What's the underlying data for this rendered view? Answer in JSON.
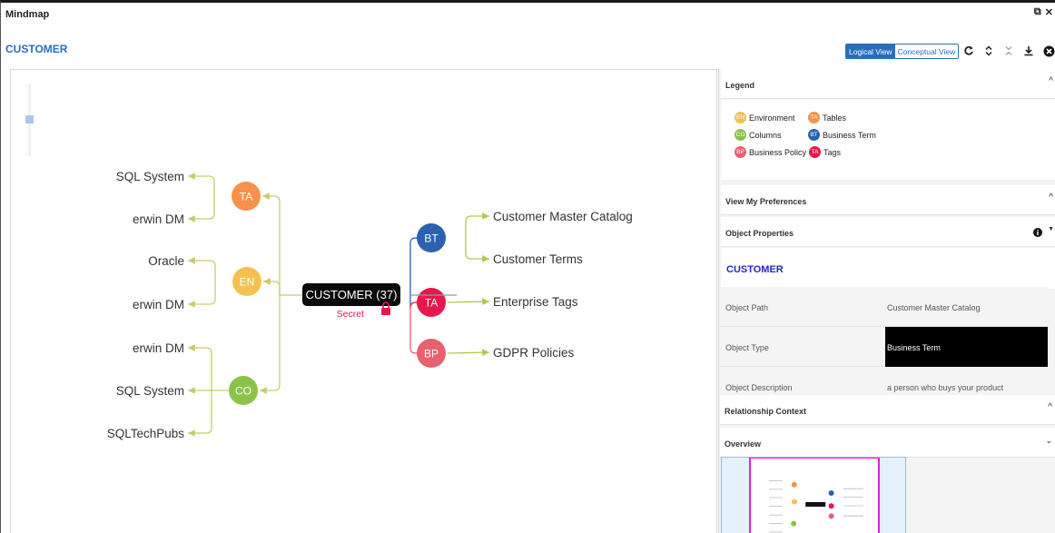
{
  "window": {
    "title": "Mindmap",
    "restore_icon": "⧉",
    "close_icon": "✕"
  },
  "header": {
    "object_name": "CUSTOMER"
  },
  "views": {
    "logical": "Logical View",
    "conceptual": "Conceptual View"
  },
  "toolbar": {
    "icons": [
      "refresh-icon",
      "expand-icon",
      "collapse-icon",
      "download-icon",
      "close-circle-icon"
    ]
  },
  "mindmap": {
    "center": {
      "label": "CUSTOMER  (37)",
      "secret": "Secret"
    },
    "left": [
      {
        "abbr": "TA",
        "color": "#f7924a",
        "children": [
          "SQL System",
          "erwin DM"
        ]
      },
      {
        "abbr": "EN",
        "color": "#f4c150",
        "children": [
          "Oracle",
          "erwin DM"
        ]
      },
      {
        "abbr": "CO",
        "color": "#8bc34a",
        "children": [
          "erwin DM",
          "SQL System",
          "SQLTechPubs"
        ]
      }
    ],
    "right": [
      {
        "abbr": "BT",
        "color": "#2a62b0",
        "children": [
          "Customer Master Catalog",
          "Customer Terms"
        ]
      },
      {
        "abbr": "TA",
        "color": "#e8184c",
        "children": [
          "Enterprise Tags"
        ]
      },
      {
        "abbr": "BP",
        "color": "#e8616e",
        "children": [
          "GDPR Policies"
        ]
      }
    ]
  },
  "legend": {
    "title": "Legend",
    "items": [
      {
        "abbr": "EN",
        "label": "Environment",
        "color": "#f4c150"
      },
      {
        "abbr": "TA",
        "label": "Tables",
        "color": "#f7924a"
      },
      {
        "abbr": "CO",
        "label": "Columns",
        "color": "#8bc34a"
      },
      {
        "abbr": "BT",
        "label": "Business Term",
        "color": "#2a62b0"
      },
      {
        "abbr": "BP",
        "label": "Business Policy",
        "color": "#e8616e"
      },
      {
        "abbr": "TA",
        "label": "Tags",
        "color": "#e8184c"
      }
    ]
  },
  "preferences": {
    "title": "View My Preferences"
  },
  "object_properties": {
    "title": "Object Properties",
    "name": "CUSTOMER",
    "rows": [
      {
        "key": "Object Path",
        "value": "Customer Master Catalog"
      },
      {
        "key": "Object Type",
        "value": "Business Term"
      },
      {
        "key": "Object Description",
        "value": "a person who buys your product"
      }
    ]
  },
  "relationship": {
    "title": "Relationship Context"
  },
  "overview": {
    "title": "Overview"
  }
}
